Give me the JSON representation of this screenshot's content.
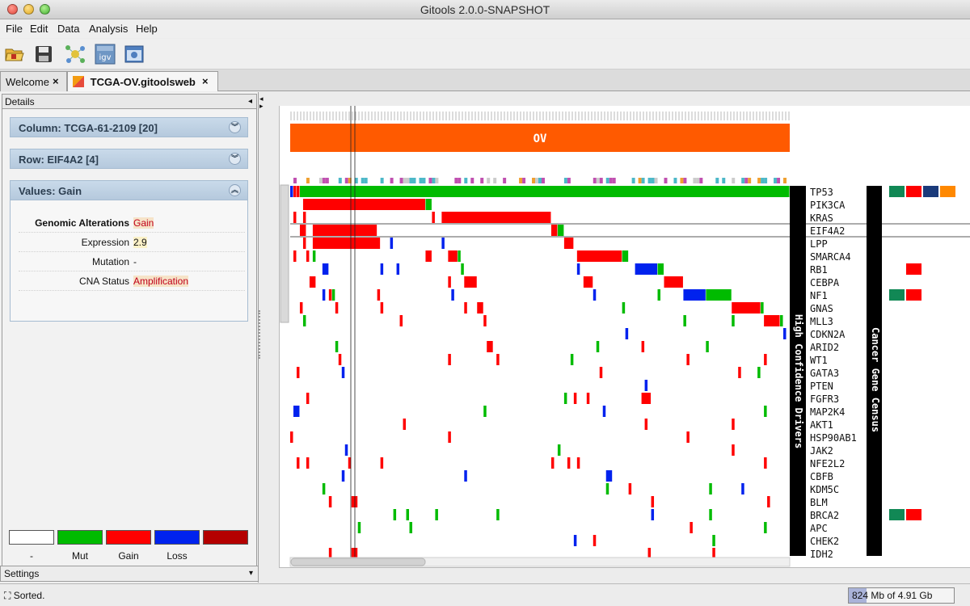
{
  "window": {
    "title": "Gitools 2.0.0-SNAPSHOT"
  },
  "menu": [
    "File",
    "Edit",
    "Data",
    "Analysis",
    "Help"
  ],
  "toolbar": {
    "icons": [
      "open-folder-icon",
      "save-icon",
      "network-icon",
      "igv-icon",
      "snapshot-icon"
    ],
    "igv_label": "igv"
  },
  "tabs": [
    {
      "label": "Welcome",
      "active": false
    },
    {
      "label": "TCGA-OV.gitoolsweb",
      "active": true
    }
  ],
  "details": {
    "header": "Details",
    "column_label": "Column: TCGA-61-2109 [20]",
    "row_label": "Row: EIF4A2 [4]",
    "values_label": "Values: Gain",
    "values": [
      {
        "key": "Genomic Alterations",
        "value": "Gain",
        "color": "#c0001b"
      },
      {
        "key": "Expression",
        "value": "2.9",
        "color": "#111111"
      },
      {
        "key": "Mutation",
        "value": "-",
        "color": "#111111"
      },
      {
        "key": "CNA Status",
        "value": "Amplification",
        "color": "#c0001b"
      }
    ]
  },
  "legend": [
    {
      "label": "-",
      "color": "#ffffff"
    },
    {
      "label": "Mut",
      "color": "#00bb00"
    },
    {
      "label": "Gain",
      "color": "#ff0000"
    },
    {
      "label": "Loss",
      "color": "#0022ee"
    },
    {
      "label": "",
      "color": "#b40000"
    }
  ],
  "settings_label": "Settings",
  "heatmap": {
    "cancer_label": "OV",
    "cancer_color": "#ff5a00",
    "rows": [
      "TP53",
      "PIK3CA",
      "KRAS",
      "EIF4A2",
      "LPP",
      "SMARCA4",
      "RB1",
      "CEBPA",
      "NF1",
      "GNAS",
      "MLL3",
      "CDKN2A",
      "ARID2",
      "WT1",
      "GATA3",
      "PTEN",
      "FGFR3",
      "MAP2K4",
      "AKT1",
      "HSP90AB1",
      "JAK2",
      "NFE2L2",
      "CBFB",
      "KDM5C",
      "BLM",
      "BRCA2",
      "APC",
      "CHEK2",
      "IDH2"
    ],
    "group_label_1": "High Confidence Drivers",
    "group_label_2": "Cancer Gene Census",
    "census_marks": [
      {
        "row": "TP53",
        "colors": [
          "#118855",
          "#ff0000",
          "#1a3a7a",
          "#ff8800"
        ]
      },
      {
        "row": "RB1",
        "colors": [
          "",
          "#ff0000"
        ]
      },
      {
        "row": "NF1",
        "colors": [
          "#118855",
          "#ff0000"
        ]
      },
      {
        "row": "BRCA2",
        "colors": [
          "#118855",
          "#ff0000"
        ]
      }
    ]
  },
  "status": {
    "text": "Sorted.",
    "memory": "824 Mb of 4.91 Gb",
    "memory_used_fraction": 0.17
  }
}
